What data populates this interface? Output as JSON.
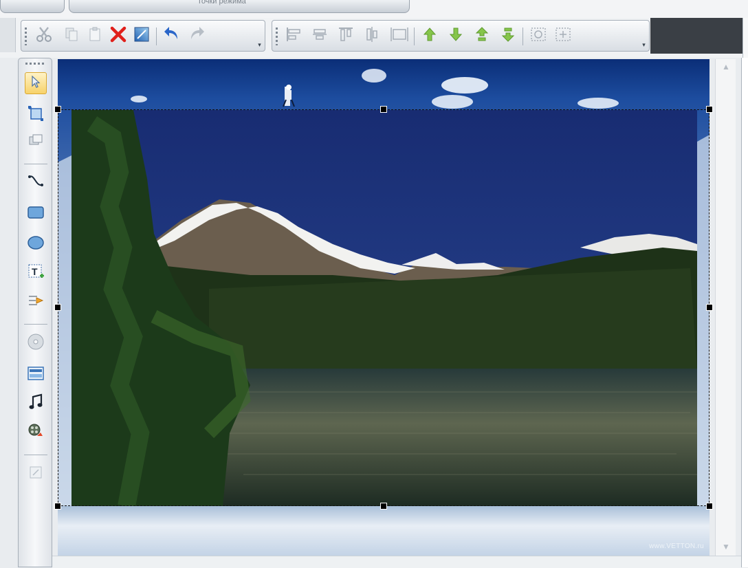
{
  "window": {
    "tab_label": "Точки режима"
  },
  "canvas": {
    "watermark": "www.VETTON.ru"
  },
  "toolbar_edit": {
    "items": [
      "cut-icon",
      "copy-icon",
      "paste-icon",
      "delete-icon",
      "fill-icon",
      "undo-icon",
      "redo-icon"
    ]
  },
  "toolbar_align": {
    "items": [
      "align-left-icon",
      "align-center-icon",
      "align-top-icon",
      "align-middle-icon",
      "same-size-icon",
      "bring-forward-icon",
      "send-backward-icon",
      "bring-to-front-icon",
      "send-to-back-icon",
      "group-icon",
      "ungroup-icon"
    ]
  },
  "left_toolbar": {
    "items": [
      "pointer-icon",
      "crop-icon",
      "duplicate-icon",
      "curve-icon",
      "rectangle-icon",
      "ellipse-icon",
      "text-icon",
      "highlight-icon",
      "disc-icon",
      "image-icon",
      "music-note-icon",
      "video-icon",
      "effect-icon"
    ],
    "active": "pointer-icon"
  },
  "colors": {
    "selection_handle": "#000000",
    "toolbar_bg": "#f0f2f4",
    "sky": "#1f3a86",
    "delete": "#e0201b"
  }
}
